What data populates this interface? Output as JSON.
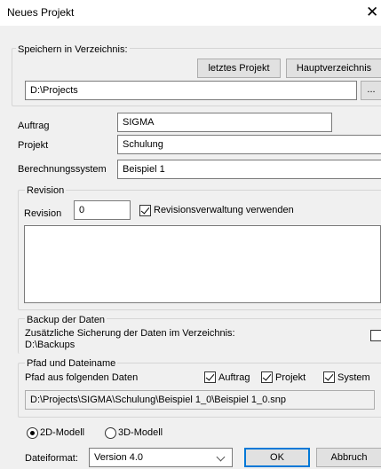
{
  "window": {
    "title": "Neues Projekt",
    "close_glyph": "✕"
  },
  "directory": {
    "legend": "Speichern in Verzeichnis:",
    "last_project_button": "letztes Projekt",
    "main_directory_button": "Hauptverzeichnis",
    "path": "D:\\Projects",
    "browse_button": "..."
  },
  "fields": {
    "auftrag_label": "Auftrag",
    "auftrag_value": "SIGMA",
    "projekt_label": "Projekt",
    "projekt_value": "Schulung",
    "system_label": "Berechnungssystem",
    "system_value": "Beispiel 1"
  },
  "revision": {
    "legend": "Revision",
    "label": "Revision",
    "value": "0",
    "use_versioning_label": "Revisionsverwaltung verwenden",
    "use_versioning_checked": true,
    "notes": ""
  },
  "backup": {
    "legend": "Backup der Daten",
    "description": "Zusätzliche Sicherung der Daten im Verzeichnis:",
    "path": "D:\\Backups",
    "checked": false
  },
  "path_name": {
    "legend": "Pfad und Dateiname",
    "from_label": "Pfad aus folgenden Daten",
    "auftrag_label": "Auftrag",
    "auftrag_checked": true,
    "projekt_label": "Projekt",
    "projekt_checked": true,
    "system_label": "System",
    "system_checked": true,
    "full_path": "D:\\Projects\\SIGMA\\Schulung\\Beispiel 1_0\\Beispiel 1_0.snp"
  },
  "model": {
    "option_2d": "2D-Modell",
    "option_3d": "3D-Modell",
    "selected": "2D-Modell"
  },
  "footer": {
    "format_label": "Dateiformat:",
    "format_value": "Version 4.0",
    "ok_button": "OK",
    "cancel_button": "Abbruch"
  }
}
